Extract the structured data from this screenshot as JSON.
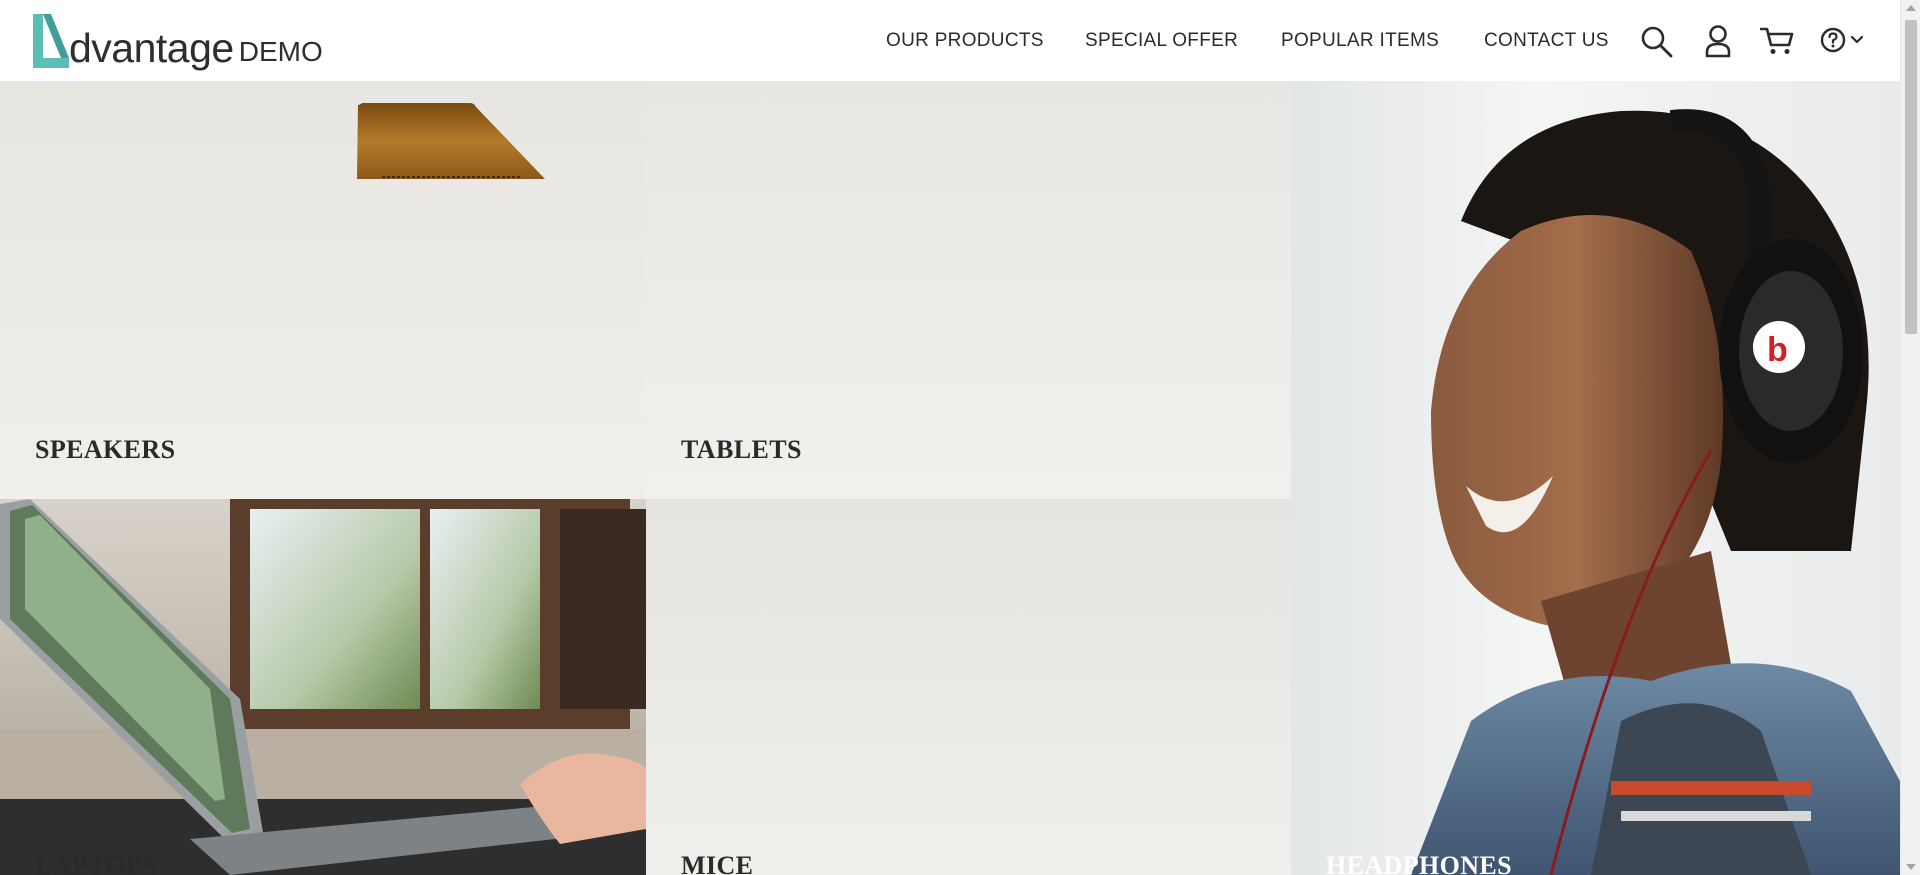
{
  "brand": {
    "logo_letter_icon": "advantage-a-logo-icon",
    "word": "dvantage",
    "suffix": "DEMO",
    "accent_color": "#5bbfb5"
  },
  "nav": {
    "items": [
      {
        "label": "OUR PRODUCTS"
      },
      {
        "label": "SPECIAL OFFER"
      },
      {
        "label": "POPULAR ITEMS"
      },
      {
        "label": "CONTACT US"
      }
    ],
    "icons": [
      "search-icon",
      "user-icon",
      "cart-icon",
      "help-icon",
      "chevron-down-icon"
    ]
  },
  "categories": [
    {
      "label": "SPEAKERS"
    },
    {
      "label": "TABLETS"
    },
    {
      "label": "LAPTOPS"
    },
    {
      "label": "MICE"
    },
    {
      "label": "HEADPHONES"
    }
  ]
}
